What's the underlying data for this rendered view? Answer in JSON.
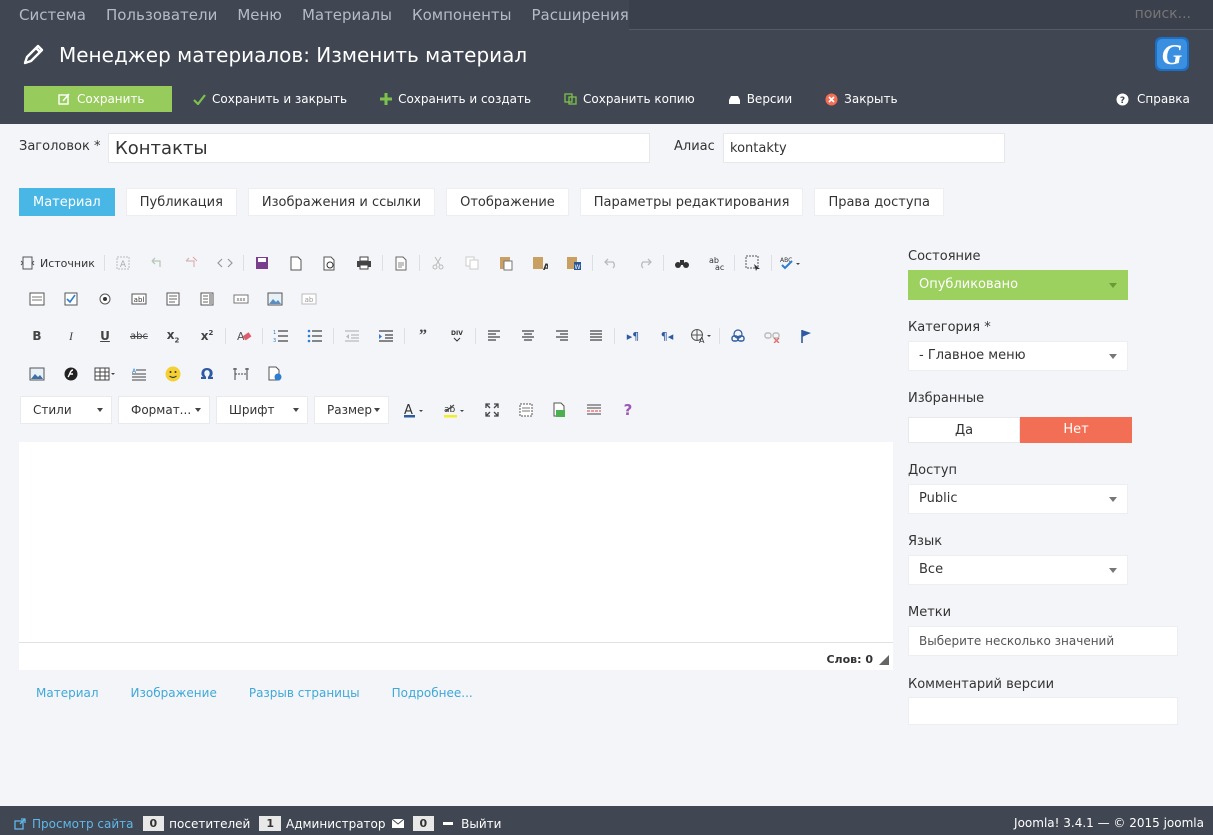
{
  "topnav": {
    "items": [
      "Система",
      "Пользователи",
      "Меню",
      "Материалы",
      "Компоненты",
      "Расширения"
    ],
    "search_placeholder": "поиск..."
  },
  "header": {
    "title": "Менеджер материалов: Изменить материал"
  },
  "toolbar": {
    "save": "Сохранить",
    "save_close": "Сохранить и закрыть",
    "save_new": "Сохранить и создать",
    "save_copy": "Сохранить копию",
    "versions": "Версии",
    "close": "Закрыть",
    "help": "Справка"
  },
  "form": {
    "title_label": "Заголовок *",
    "title_value": "Контакты",
    "alias_label": "Алиас",
    "alias_value": "kontakty"
  },
  "tabs": [
    "Материал",
    "Публикация",
    "Изображения и ссылки",
    "Отображение",
    "Параметры редактирования",
    "Права доступа"
  ],
  "editor": {
    "source_label": "Источник",
    "dropdowns": [
      "Стили",
      "Формат...",
      "Шрифт",
      "Размер"
    ],
    "word_count": "Слов: 0",
    "extra_buttons": [
      "Материал",
      "Изображение",
      "Разрыв страницы",
      "Подробнее..."
    ]
  },
  "sidebar": {
    "state_label": "Состояние",
    "state_value": "Опубликовано",
    "category_label": "Категория *",
    "category_value": "- Главное меню",
    "featured_label": "Избранные",
    "featured_yes": "Да",
    "featured_no": "Нет",
    "access_label": "Доступ",
    "access_value": "Public",
    "language_label": "Язык",
    "language_value": "Все",
    "tags_label": "Метки",
    "tags_placeholder": "Выберите несколько значений",
    "version_note_label": "Комментарий версии"
  },
  "footer": {
    "view_site": "Просмотр сайта",
    "visitors_count": "0",
    "visitors_label": "посетителей",
    "admin_count": "1",
    "admin_label": "Администратор",
    "messages_count": "0",
    "logout": "Выйти",
    "version": "Joomla! 3.4.1  —  © 2015 joomla"
  },
  "colors": {
    "header_bg": "#404652",
    "save_green": "#97cc5c",
    "active_tab": "#48b7e6",
    "no_red": "#f26e55",
    "published_green": "#9cd160"
  }
}
